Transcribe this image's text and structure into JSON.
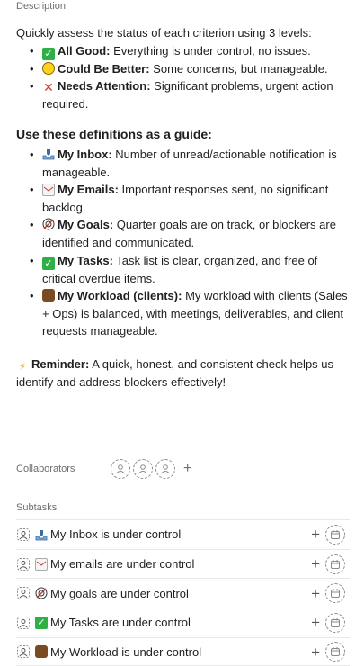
{
  "description": {
    "label": "Description",
    "intro": "Quickly assess the status of each criterion using 3 levels:",
    "levels": [
      {
        "icon": "check-box-icon",
        "bold": "All Good:",
        "text": " Everything is under control, no issues."
      },
      {
        "icon": "yellow-circle-icon",
        "bold": "Could Be Better:",
        "text": " Some concerns, but manageable."
      },
      {
        "icon": "red-x-icon",
        "bold": "Needs Attention:",
        "text": " Significant problems, urgent action required."
      }
    ],
    "guide_heading": "Use these definitions as a guide:",
    "definitions": [
      {
        "icon": "inbox-tray-icon",
        "bold": "My Inbox:",
        "text": " Number of unread/actionable notification is manageable."
      },
      {
        "icon": "envelope-icon",
        "bold": "My Emails:",
        "text": " Important responses sent, no significant backlog."
      },
      {
        "icon": "target-icon",
        "bold": "My Goals:",
        "text": " Quarter goals are on track, or blockers are identified and communicated."
      },
      {
        "icon": "check-box-icon",
        "bold": "My Tasks:",
        "text": " Task list is clear, organized, and free of critical overdue items."
      },
      {
        "icon": "briefcase-icon",
        "bold": "My Workload (clients):",
        "text": " My workload with clients (Sales + Ops) is balanced, with meetings, deliverables, and client requests manageable."
      }
    ],
    "reminder_bold": "Reminder:",
    "reminder_text": " A quick, honest, and consistent check helps us identify and address blockers effectively!"
  },
  "collaborators": {
    "label": "Collaborators",
    "add": "+"
  },
  "subtasks": {
    "label": "Subtasks",
    "add": "+",
    "items": [
      {
        "icon": "inbox-tray-icon",
        "title": "My Inbox is under control"
      },
      {
        "icon": "envelope-icon",
        "title": "My emails are under control"
      },
      {
        "icon": "target-icon",
        "title": "My goals are under control"
      },
      {
        "icon": "check-box-icon",
        "title": "My Tasks are under control"
      },
      {
        "icon": "briefcase-icon",
        "title": "My Workload is under control"
      }
    ]
  }
}
